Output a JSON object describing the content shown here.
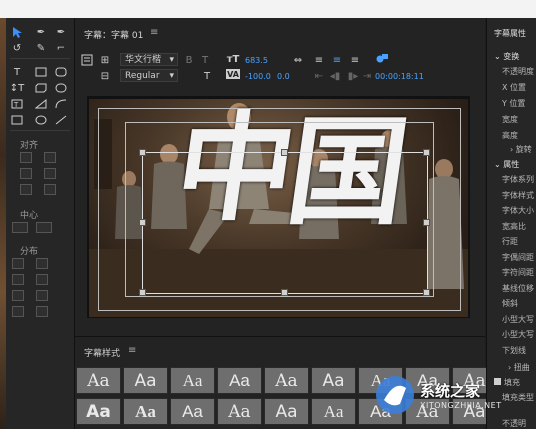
{
  "panel_title": "字幕：字幕 01",
  "styles_panel_title": "字幕样式",
  "right_panel_title": "字幕属性",
  "left_panel": {
    "align_label": "对齐",
    "center_label": "中心",
    "distribute_label": "分布"
  },
  "toolbar": {
    "font_family": "华文行楷",
    "font_style": "Regular",
    "font_size": "683.5",
    "kerning": "-100.0",
    "leading": "0.0",
    "timecode": "00:00:18:11"
  },
  "canvas_text": "中国",
  "style_swatch_label": "Aa",
  "right_panel": {
    "transform_header": "变换",
    "transform_items": [
      "不透明度",
      "X 位置",
      "Y 位置",
      "宽度",
      "高度"
    ],
    "rotation": "旋转",
    "properties_header": "属性",
    "property_items": [
      "字体系列",
      "字体样式",
      "字体大小",
      "宽高比",
      "行距",
      "字偶间距",
      "字符间距",
      "基线位移",
      "倾斜",
      "小型大写",
      "小型大写",
      "下划线"
    ],
    "distort": "扭曲",
    "fill": "填充",
    "fill_type": "填充类型",
    "opacity": "不透明"
  },
  "watermark": {
    "name": "系统之家",
    "url": "XITONGZHIJIA.NET"
  },
  "colors": {
    "accent": "#4aa3ff",
    "panel_bg": "#232323",
    "text_fill": "#f2f2f2"
  }
}
